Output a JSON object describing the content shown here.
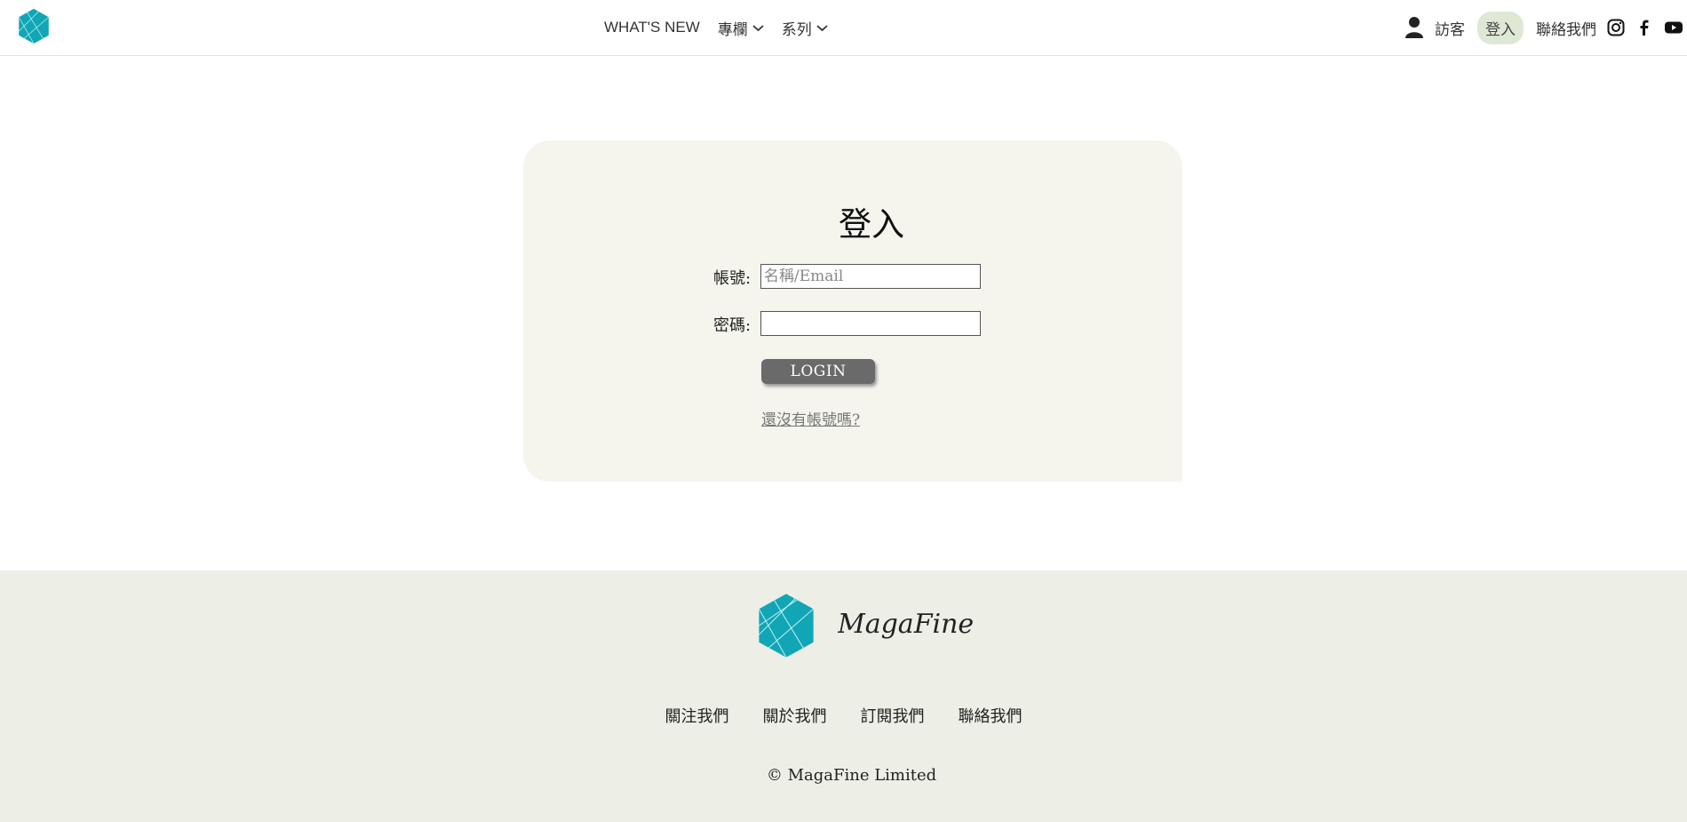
{
  "header": {
    "logo": {
      "icon": "hexagon-logo-icon",
      "color": "#11a6b5"
    },
    "nav": [
      {
        "label": "WHAT'S NEW",
        "has_dropdown": false
      },
      {
        "label": "專欄",
        "has_dropdown": true
      },
      {
        "label": "系列",
        "has_dropdown": true
      }
    ],
    "right": {
      "user_icon": "user-icon",
      "guest_label": "訪客",
      "login_label": "登入",
      "contact_label": "聯絡我們",
      "social": [
        "instagram-icon",
        "facebook-icon",
        "youtube-icon"
      ]
    }
  },
  "login_card": {
    "title": "登入",
    "account_label": "帳號:",
    "account_placeholder": "名稱/Email",
    "account_value": "",
    "password_label": "密碼:",
    "password_value": "",
    "login_button": "LOGIN",
    "register_link": "還沒有帳號嗎?",
    "background": "#f5f5ee"
  },
  "footer": {
    "links": [
      "關注我們",
      "關於我們",
      "訂閱我們",
      "聯絡我們"
    ],
    "copyright": "© MagaFine Limited",
    "background": "#edefe6"
  },
  "colors": {
    "brand_teal": "#11a6b5",
    "login_pill": "#dfe8d5",
    "button_gray": "#6a6a6a"
  }
}
